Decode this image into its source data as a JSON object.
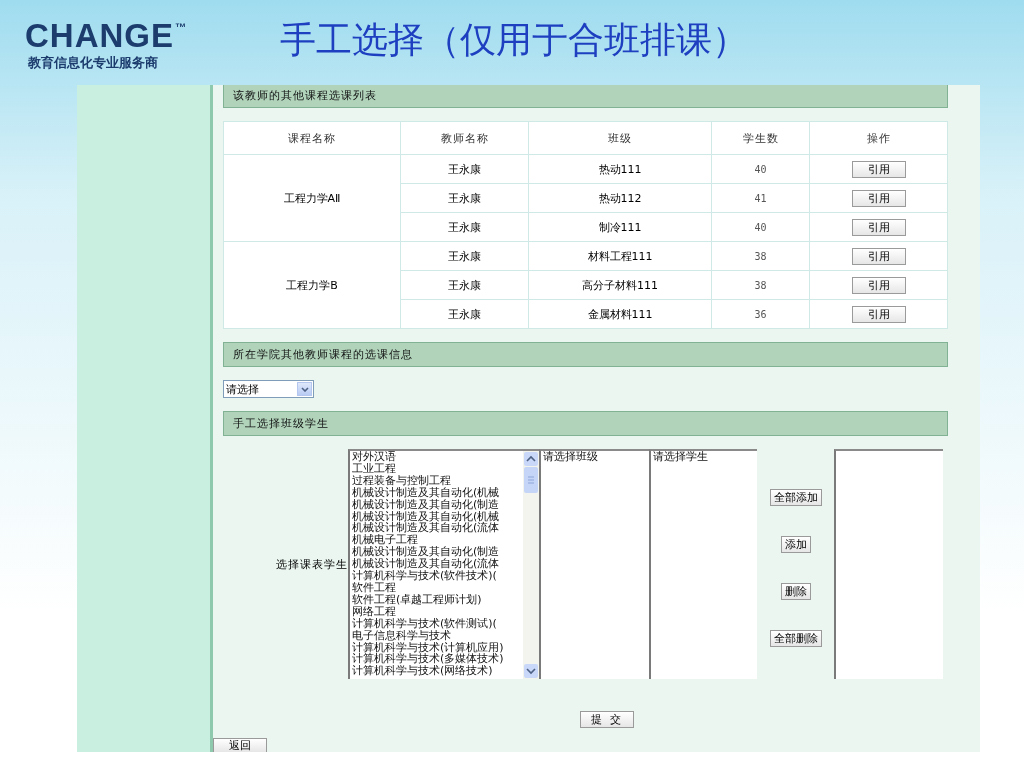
{
  "slide": {
    "logo": {
      "name": "CHANGE",
      "mark": "™",
      "tagline": "教育信息化专业服务商"
    },
    "title": "手工选择（仅用于合班排课）"
  },
  "teacher_courses": {
    "heading": "该教师的其他课程选课列表",
    "columns": [
      "课程名称",
      "教师名称",
      "班级",
      "学生数",
      "操作"
    ],
    "groups": [
      {
        "course": "工程力学AⅡ",
        "rows": [
          {
            "teacher": "王永康",
            "class": "热动111",
            "students": "40",
            "action": "引用"
          },
          {
            "teacher": "王永康",
            "class": "热动112",
            "students": "41",
            "action": "引用"
          },
          {
            "teacher": "王永康",
            "class": "制冷111",
            "students": "40",
            "action": "引用"
          }
        ]
      },
      {
        "course": "工程力学B",
        "rows": [
          {
            "teacher": "王永康",
            "class": "材料工程111",
            "students": "38",
            "action": "引用"
          },
          {
            "teacher": "王永康",
            "class": "高分子材料111",
            "students": "38",
            "action": "引用"
          },
          {
            "teacher": "王永康",
            "class": "金属材料111",
            "students": "36",
            "action": "引用"
          }
        ]
      }
    ]
  },
  "college_courses": {
    "heading": "所在学院其他教师课程的选课信息",
    "select": {
      "value": "请选择"
    }
  },
  "manual": {
    "heading": "手工选择班级学生",
    "label": "选择课表学生",
    "majors": [
      "对外汉语",
      "工业工程",
      "过程装备与控制工程",
      "机械设计制造及其自动化(机械",
      "机械设计制造及其自动化(制造",
      "机械设计制造及其自动化(机械",
      "机械设计制造及其自动化(流体",
      "机械电子工程",
      "机械设计制造及其自动化(制造",
      "机械设计制造及其自动化(流体",
      "计算机科学与技术(软件技术)(",
      "软件工程",
      "软件工程(卓越工程师计划)",
      "网络工程",
      "计算机科学与技术(软件测试)(",
      "电子信息科学与技术",
      "计算机科学与技术(计算机应用)",
      "计算机科学与技术(多媒体技术)",
      "计算机科学与技术(网络技术)"
    ],
    "classes": [
      "请选择班级"
    ],
    "students": [
      "请选择学生"
    ],
    "buttons": [
      "全部添加",
      "添加",
      "删除",
      "全部删除"
    ]
  },
  "submit": "提 交",
  "back": "返回"
}
